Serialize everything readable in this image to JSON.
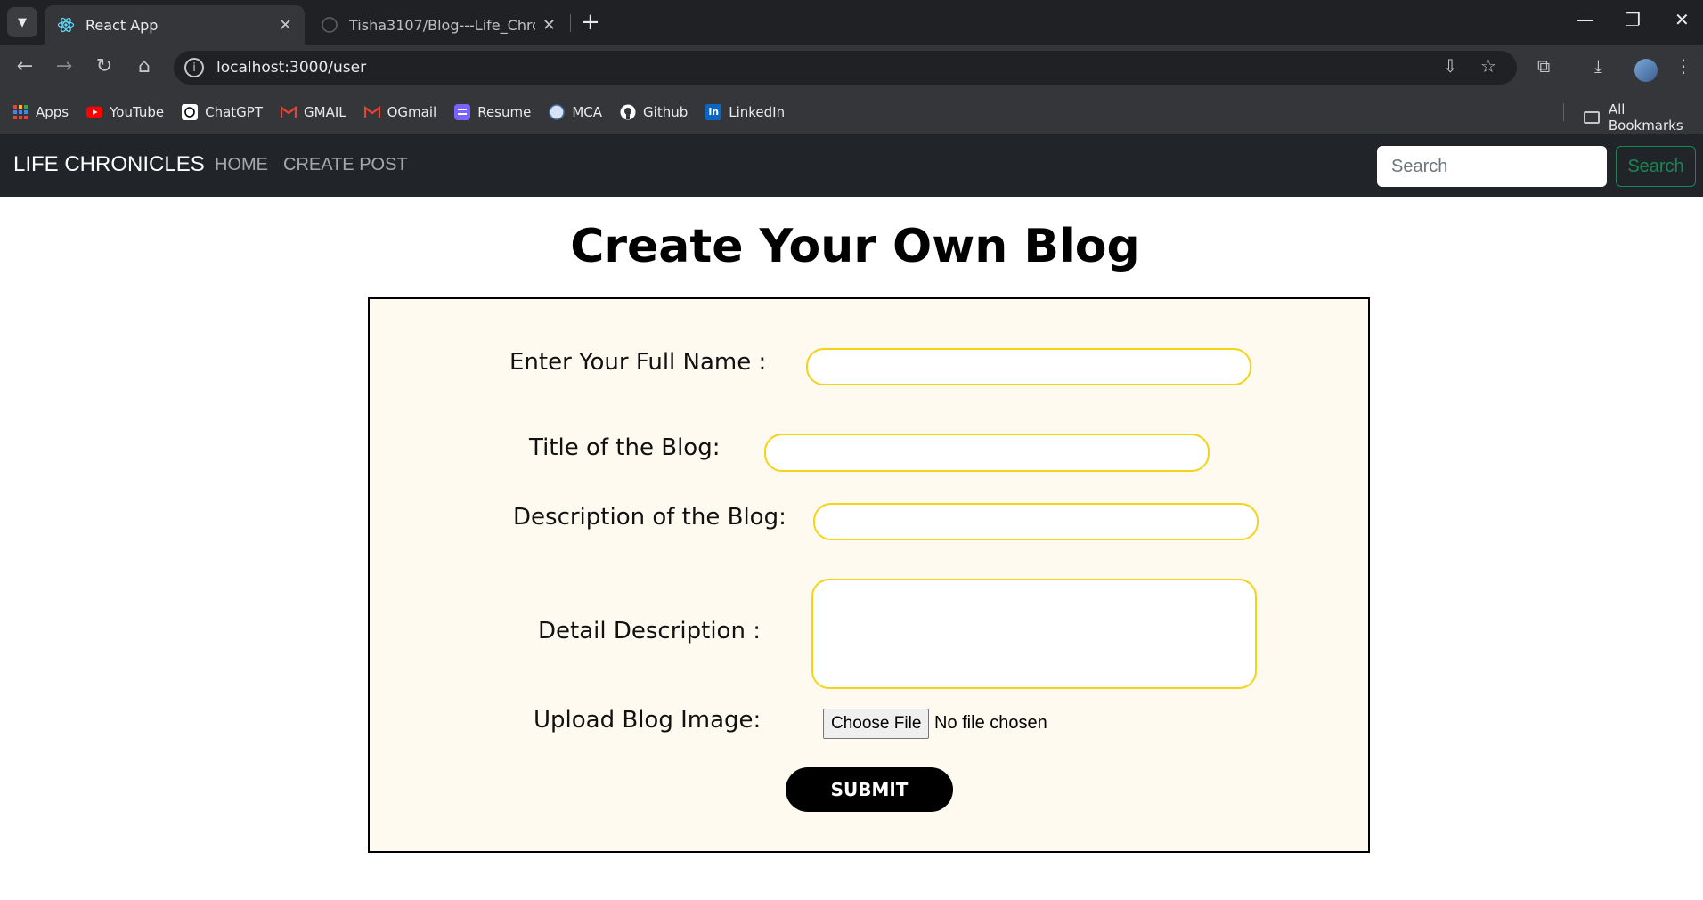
{
  "browser": {
    "tabs": [
      {
        "title": "React App",
        "active": true
      },
      {
        "title": "Tisha3107/Blog---Life_Chronicles",
        "active": false
      }
    ],
    "url": "localhost:3000/user",
    "bookmarks": [
      {
        "label": "Apps",
        "icon": "apps-grid-icon"
      },
      {
        "label": "YouTube",
        "icon": "youtube-icon"
      },
      {
        "label": "ChatGPT",
        "icon": "chatgpt-icon"
      },
      {
        "label": "GMAIL",
        "icon": "gmail-icon"
      },
      {
        "label": "OGmail",
        "icon": "gmail-icon"
      },
      {
        "label": "Resume",
        "icon": "resume-icon"
      },
      {
        "label": "MCA",
        "icon": "mca-icon"
      },
      {
        "label": "Github",
        "icon": "github-icon"
      },
      {
        "label": "LinkedIn",
        "icon": "linkedin-icon"
      }
    ],
    "all_bookmarks": "All Bookmarks"
  },
  "navbar": {
    "brand": "LIFE CHRONICLES",
    "links": [
      "HOME",
      "CREATE POST"
    ],
    "search_placeholder": "Search",
    "search_button": "Search",
    "bg_color": "#212529",
    "search_btn_color": "#198754"
  },
  "page": {
    "title": "Create Your Own Blog"
  },
  "form": {
    "full_name_label": "Enter Your Full Name :",
    "title_label": "Title of the Blog:",
    "description_label": "Description of the Blog:",
    "detail_label": "Detail Description :",
    "upload_label": "Upload Blog Image:",
    "choose_file": "Choose File",
    "no_file": "No file chosen",
    "submit": "SUBMIT",
    "input_border_color": "#f5d316",
    "box_bg_color": "#fffaf0"
  }
}
